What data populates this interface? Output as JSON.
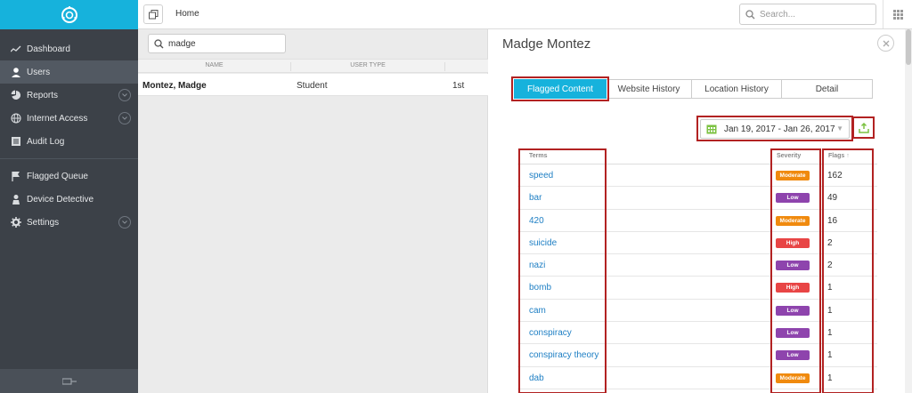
{
  "sidebar": {
    "items": [
      {
        "label": "Dashboard",
        "icon": "chart-line-icon",
        "active": false,
        "expandable": false
      },
      {
        "label": "Users",
        "icon": "user-icon",
        "active": true,
        "expandable": false
      },
      {
        "label": "Reports",
        "icon": "pie-chart-icon",
        "active": false,
        "expandable": true
      },
      {
        "label": "Internet Access",
        "icon": "globe-icon",
        "active": false,
        "expandable": true
      },
      {
        "label": "Audit Log",
        "icon": "list-icon",
        "active": false,
        "expandable": false
      }
    ],
    "items2": [
      {
        "label": "Flagged Queue",
        "icon": "flag-icon",
        "active": false,
        "expandable": false
      },
      {
        "label": "Device Detective",
        "icon": "person-icon",
        "active": false,
        "expandable": false
      },
      {
        "label": "Settings",
        "icon": "gear-icon",
        "active": false,
        "expandable": true
      }
    ]
  },
  "topbar": {
    "breadcrumb": "Home",
    "search_placeholder": "Search..."
  },
  "list": {
    "search_value": "madge",
    "columns": [
      "NAME",
      "USER TYPE"
    ],
    "rows": [
      {
        "name": "Montez, Madge",
        "type": "Student",
        "grade": "1st"
      }
    ]
  },
  "detail": {
    "title": "Madge Montez",
    "tabs": [
      "Flagged Content",
      "Website History",
      "Location History",
      "Detail"
    ],
    "date_range": "Jan 19, 2017 - Jan 26, 2017",
    "table": {
      "headers": {
        "terms": "Terms",
        "severity": "Severity",
        "flags": "Flags"
      },
      "rows": [
        {
          "term": "speed",
          "severity": "Moderate",
          "flags": "162"
        },
        {
          "term": "bar",
          "severity": "Low",
          "flags": "49"
        },
        {
          "term": "420",
          "severity": "Moderate",
          "flags": "16"
        },
        {
          "term": "suicide",
          "severity": "High",
          "flags": "2"
        },
        {
          "term": "nazi",
          "severity": "Low",
          "flags": "2"
        },
        {
          "term": "bomb",
          "severity": "High",
          "flags": "1"
        },
        {
          "term": "cam",
          "severity": "Low",
          "flags": "1"
        },
        {
          "term": "conspiracy",
          "severity": "Low",
          "flags": "1"
        },
        {
          "term": "conspiracy theory",
          "severity": "Low",
          "flags": "1"
        },
        {
          "term": "dab",
          "severity": "Moderate",
          "flags": "1"
        }
      ]
    }
  },
  "colors": {
    "accent": "#16b2dc",
    "sidebar": "#3c4148",
    "moderate": "#f08a0e",
    "low": "#8e44ad",
    "high": "#e84545",
    "highlight": "#b22222",
    "link": "#1e7fc4"
  }
}
